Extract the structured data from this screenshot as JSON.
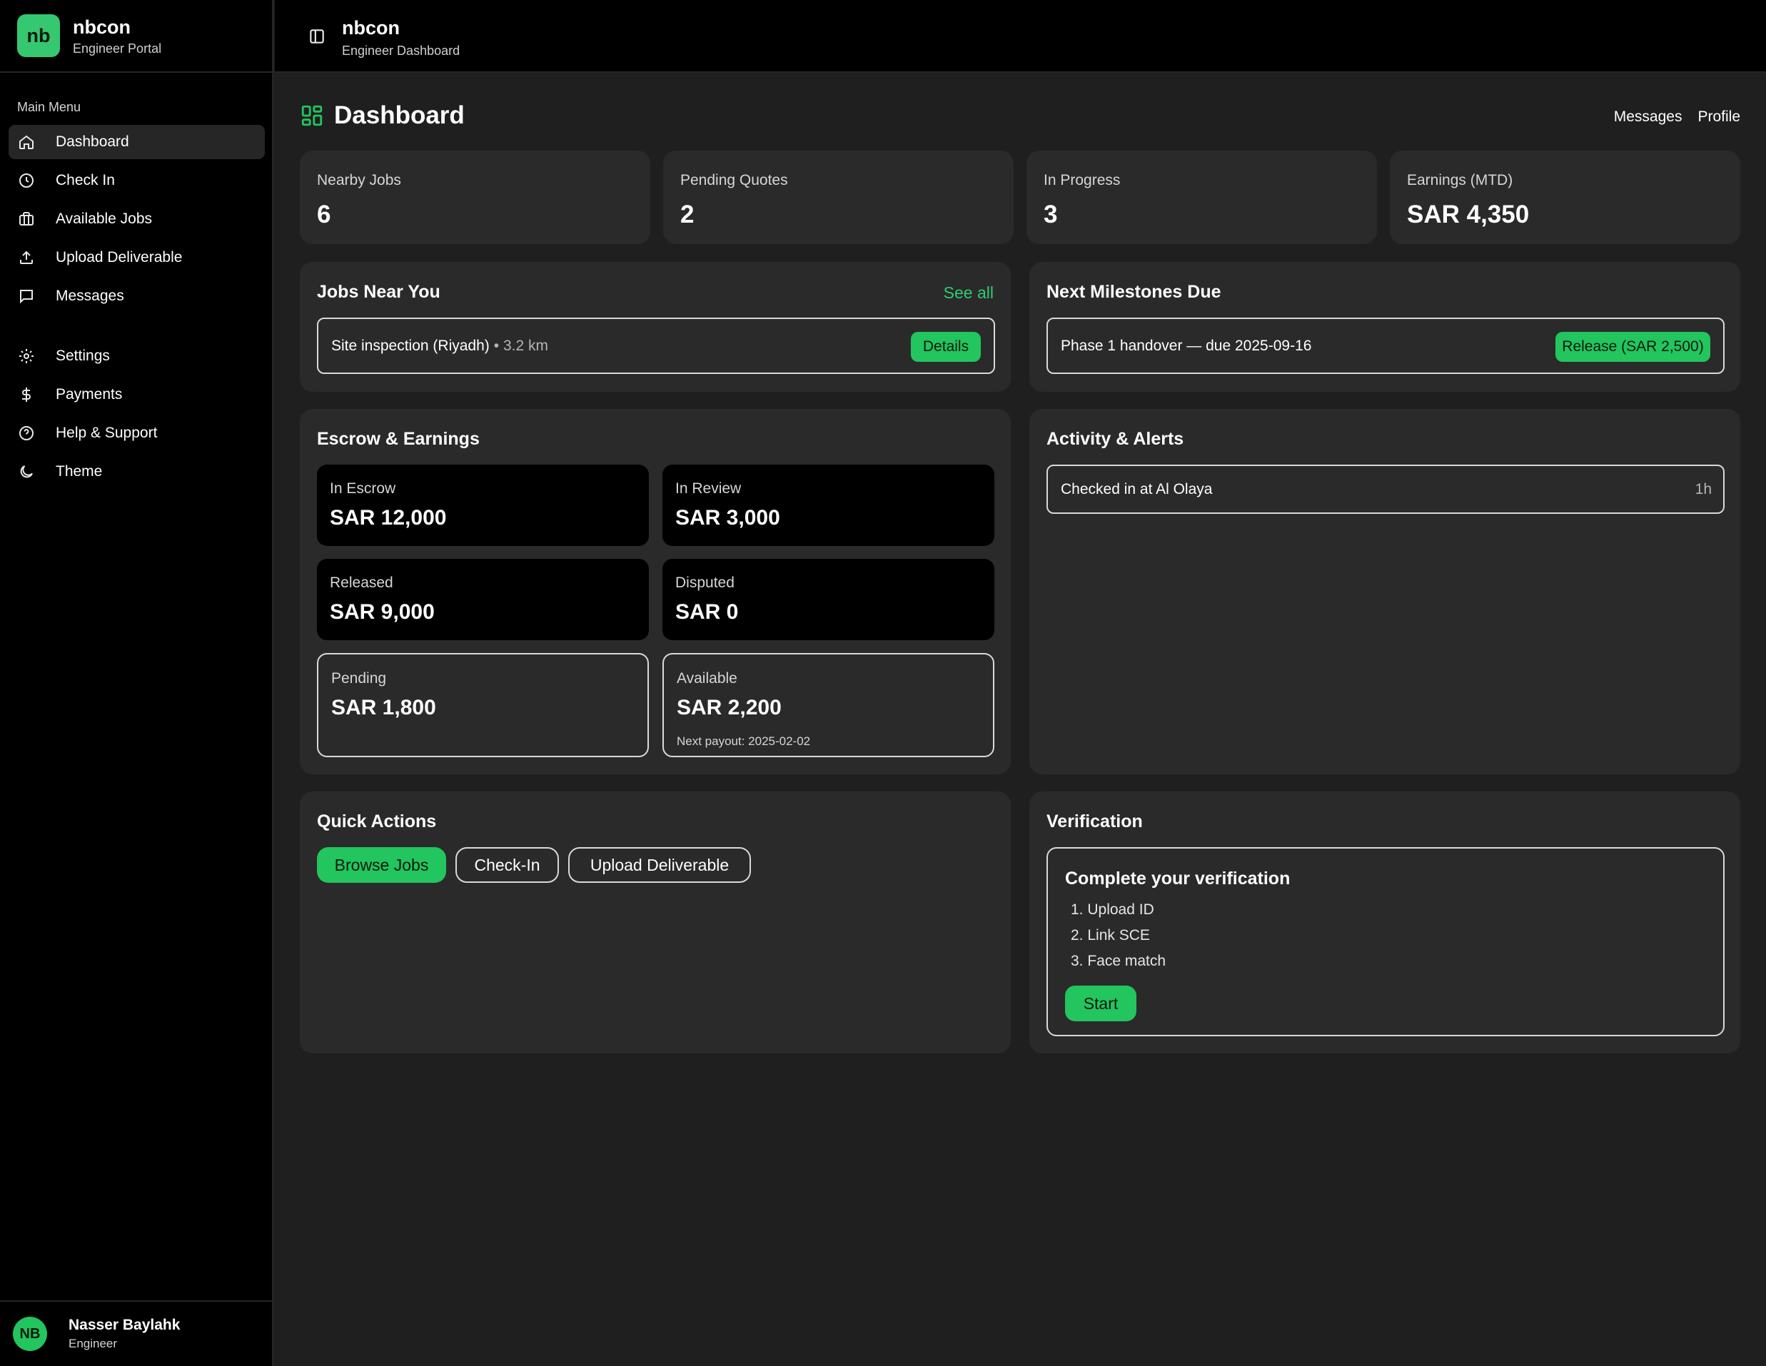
{
  "brand": {
    "logo": "nb",
    "name": "nbcon",
    "subtitle": "Engineer Portal"
  },
  "header": {
    "title": "nbcon",
    "subtitle": "Engineer Dashboard",
    "panel_icon": "sidebar-toggle-icon"
  },
  "sidebar": {
    "section_label": "Main Menu",
    "items": [
      {
        "label": "Dashboard",
        "icon": "home-icon",
        "active": true
      },
      {
        "label": "Check In",
        "icon": "clock-icon"
      },
      {
        "label": "Available Jobs",
        "icon": "briefcase-icon"
      },
      {
        "label": "Upload Deliverable",
        "icon": "upload-icon"
      },
      {
        "label": "Messages",
        "icon": "message-icon"
      },
      {
        "label": "Settings",
        "icon": "gear-icon"
      },
      {
        "label": "Payments",
        "icon": "dollar-icon"
      },
      {
        "label": "Help & Support",
        "icon": "help-icon"
      },
      {
        "label": "Theme",
        "icon": "moon-icon"
      }
    ]
  },
  "user": {
    "initials": "NB",
    "name": "Nasser Baylahk",
    "role": "Engineer"
  },
  "page": {
    "title": "Dashboard",
    "links": [
      "Messages",
      "Profile"
    ]
  },
  "stats": [
    {
      "label": "Nearby Jobs",
      "value": "6"
    },
    {
      "label": "Pending Quotes",
      "value": "2"
    },
    {
      "label": "In Progress",
      "value": "3"
    },
    {
      "label": "Earnings (MTD)",
      "value": "SAR 4,350"
    }
  ],
  "jobs_near": {
    "title": "Jobs Near You",
    "see_all": "See all",
    "job_title": "Site inspection (Riyadh)",
    "job_distance": "• 3.2 km",
    "details_label": "Details"
  },
  "milestones": {
    "title": "Next Milestones Due",
    "item": "Phase 1 handover — due 2025-09-16",
    "release_label": "Release (SAR 2,500)"
  },
  "escrow": {
    "title": "Escrow & Earnings",
    "tiles": [
      {
        "label": "In Escrow",
        "value": "SAR 12,000"
      },
      {
        "label": "In Review",
        "value": "SAR 3,000"
      },
      {
        "label": "Released",
        "value": "SAR 9,000"
      },
      {
        "label": "Disputed",
        "value": "SAR 0"
      },
      {
        "label": "Pending",
        "value": "SAR 1,800"
      },
      {
        "label": "Available",
        "value": "SAR 2,200",
        "note": "Next payout: 2025-02-02"
      }
    ]
  },
  "activity": {
    "title": "Activity & Alerts",
    "item": "Checked in at Al Olaya",
    "time": "1h"
  },
  "quick_actions": {
    "title": "Quick Actions",
    "buttons": [
      "Browse Jobs",
      "Check-In",
      "Upload Deliverable"
    ]
  },
  "verification": {
    "title": "Verification",
    "box_title": "Complete your verification",
    "steps": [
      "1. Upload ID",
      "2. Link SCE",
      "3. Face match"
    ],
    "start_label": "Start"
  },
  "colors": {
    "accent": "#22c55e",
    "background": "#1f1f1f",
    "card": "#2a2a2a",
    "sidebar": "#000000"
  }
}
